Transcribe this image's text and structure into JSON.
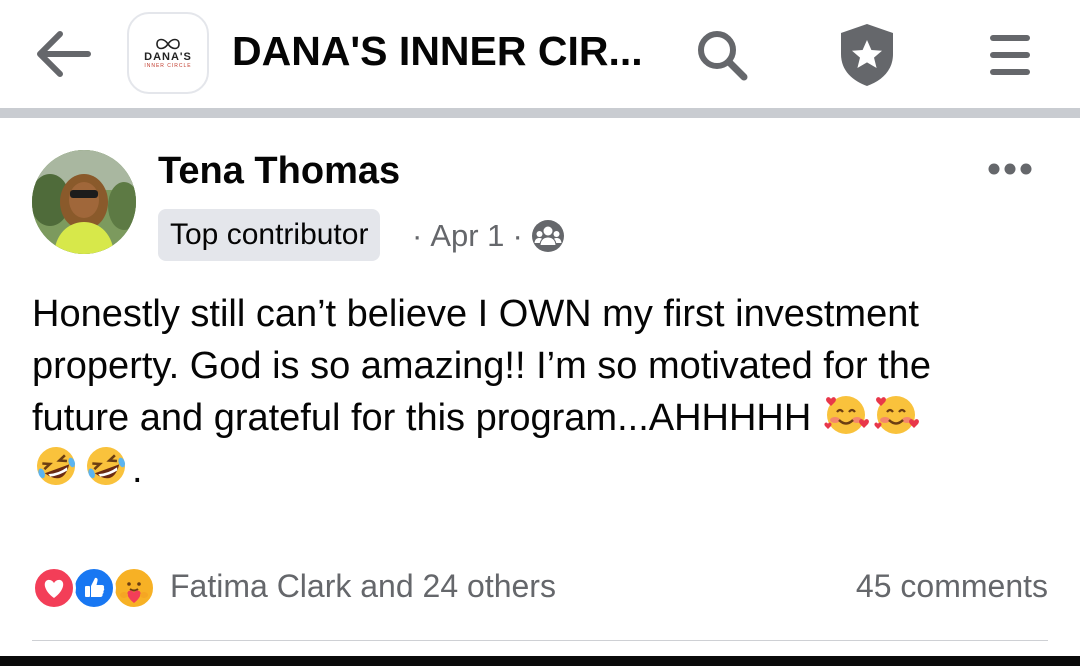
{
  "header": {
    "back_icon": "arrow-left-icon",
    "logo": {
      "name": "DANA'S",
      "subtitle": "INNER CIRCLE"
    },
    "title": "DANA'S INNER CIR...",
    "search_icon": "search-icon",
    "admin_icon": "shield-star-icon",
    "menu_icon": "menu-icon"
  },
  "post": {
    "author": "Tena Thomas",
    "badge": "Top contributor",
    "date": "Apr 1",
    "separator": "·",
    "privacy_icon": "group-members-icon",
    "more_icon": "more-horizontal-icon",
    "text_line1": "Honestly still can’t believe I OWN my first investment",
    "text_line2": "property. God is so amazing!! I’m so motivated for the",
    "text_line3": "future and grateful for this program...AHHHHH",
    "text_end": ".",
    "emojis": [
      "smiling-face-with-hearts",
      "smiling-face-with-hearts",
      "rolling-on-floor-laughing",
      "rolling-on-floor-laughing"
    ]
  },
  "footer": {
    "reactions": [
      "love",
      "like",
      "care"
    ],
    "reaction_summary": "Fatima Clark and 24 others",
    "comments": "45 comments"
  },
  "colors": {
    "secondary_text": "#65676b",
    "badge_bg": "#e4e6eb",
    "like_blue": "#1877f2",
    "love_red": "#f33e58",
    "care_yellow": "#f7b125"
  }
}
